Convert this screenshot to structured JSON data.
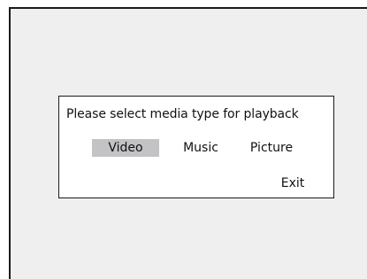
{
  "dialog": {
    "prompt": "Please select media type for playback",
    "options": [
      {
        "label": "Video",
        "selected": true
      },
      {
        "label": "Music",
        "selected": false
      },
      {
        "label": "Picture",
        "selected": false
      }
    ],
    "exit_label": "Exit"
  },
  "colors": {
    "background": "#efeff0",
    "dialog_background": "#ffffff",
    "selection_highlight": "#c3c3c6",
    "border": "#1a1a1a",
    "text": "#111111"
  }
}
